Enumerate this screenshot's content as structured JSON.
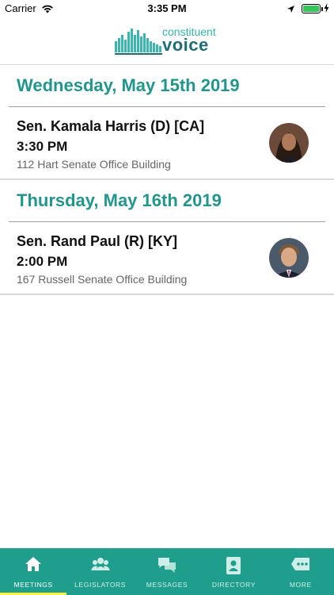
{
  "status": {
    "carrier": "Carrier",
    "time": "3:35 PM",
    "battery_fraction": 1.0
  },
  "logo": {
    "line1": "constituent",
    "line2": "voice",
    "colors": {
      "teal": "#35b3ad",
      "dark": "#1f6e73"
    }
  },
  "meetings": [
    {
      "day": "Wednesday, May 15th 2019",
      "senator": "Sen. Kamala Harris (D) [CA]",
      "time": "3:30 PM",
      "room": "112 Hart Senate Office Building",
      "avatar_icon": "senator-portrait"
    },
    {
      "day": "Thursday, May 16th 2019",
      "senator": "Sen. Rand Paul (R) [KY]",
      "time": "2:00 PM",
      "room": "167 Russell Senate Office Building",
      "avatar_icon": "senator-portrait"
    }
  ],
  "tabs": [
    {
      "label": "MEETINGS",
      "icon": "home-icon",
      "active": true
    },
    {
      "label": "LEGISLATORS",
      "icon": "people-icon",
      "active": false
    },
    {
      "label": "MESSAGES",
      "icon": "chat-bubbles-icon",
      "active": false
    },
    {
      "label": "DIRECTORY",
      "icon": "contact-card-icon",
      "active": false
    },
    {
      "label": "MORE",
      "icon": "more-icon",
      "active": false
    }
  ],
  "colors": {
    "accent": "#22958d",
    "tabbar": "#1f9e8e",
    "active_indicator": "#ffef3a"
  }
}
